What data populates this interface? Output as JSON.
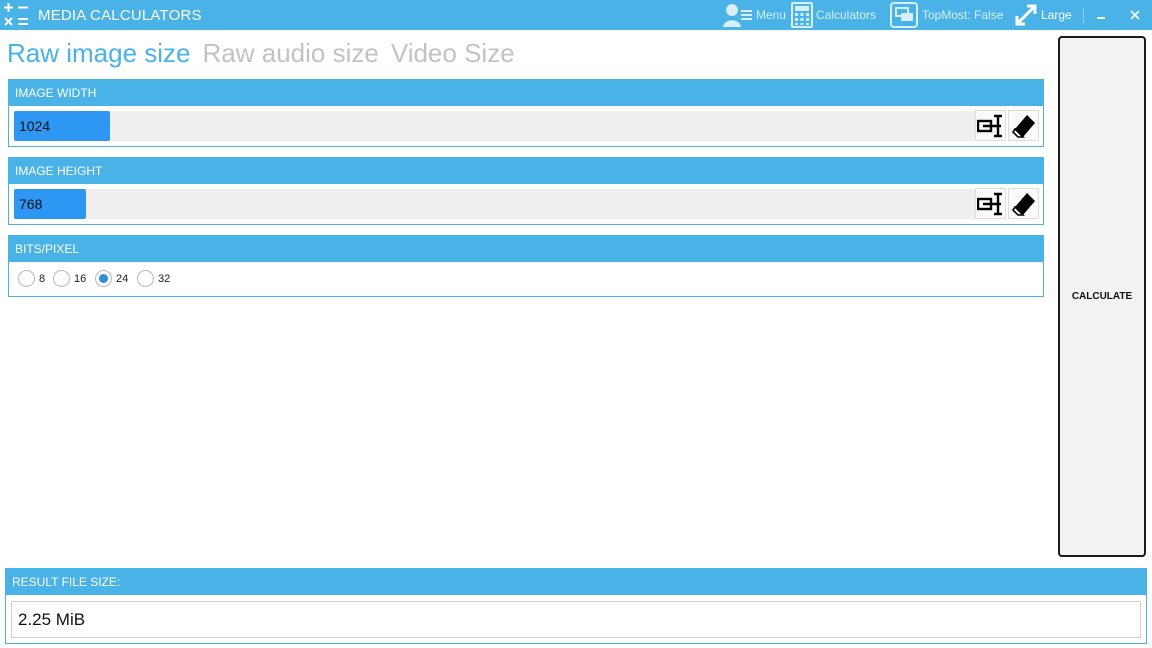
{
  "window": {
    "title": "MEDIA CALCULATORS",
    "accent_color": "#49b2e6",
    "icon": "calculator-grid-icon"
  },
  "toolbar": {
    "menu_label": "Menu",
    "calculators_label": "Calculators",
    "topmost_label": "TopMost: False",
    "size_label": "Large"
  },
  "tabs": [
    {
      "label": "Raw image size",
      "active": true
    },
    {
      "label": "Raw audio size",
      "active": false
    },
    {
      "label": "Video Size",
      "active": false
    }
  ],
  "fields": {
    "width": {
      "label": "IMAGE WIDTH",
      "value": "1024",
      "fill_fraction": 0.1
    },
    "height": {
      "label": "IMAGE HEIGHT",
      "value": "768",
      "fill_fraction": 0.075
    }
  },
  "bits": {
    "label": "BITS/PIXEL",
    "options": [
      "8",
      "16",
      "24",
      "32"
    ],
    "selected": "24"
  },
  "calculate_label": "CALCULATE",
  "result": {
    "label": "RESULT FILE SIZE:",
    "value": "2.25 MiB"
  }
}
